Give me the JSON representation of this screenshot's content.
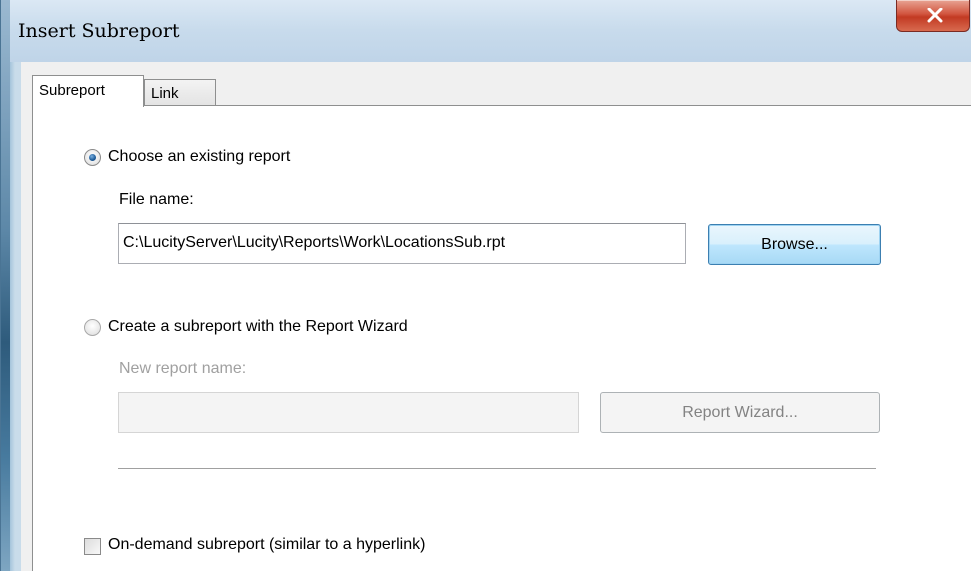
{
  "window": {
    "title": "Insert Subreport",
    "close_glyph": "X"
  },
  "tabs": [
    {
      "label": "Subreport",
      "selected": true
    },
    {
      "label": "Link",
      "selected": false
    }
  ],
  "existing_report": {
    "option_label": "Choose an existing report",
    "selected": true,
    "file_name_label": "File name:",
    "file_name_value": "C:\\LucityServer\\Lucity\\Reports\\Work\\LocationsSub.rpt",
    "browse_label": "Browse..."
  },
  "wizard_report": {
    "option_label": "Create a subreport with the Report Wizard",
    "selected": false,
    "new_name_label": "New report name:",
    "new_name_value": "",
    "wizard_button_label": "Report Wizard..."
  },
  "on_demand": {
    "label": "On-demand subreport (similar to a hyperlink)",
    "checked": false
  },
  "colors": {
    "close_button": "#c23a23",
    "radio_dot": "#1c5a98",
    "focus_border": "#3c7fb1"
  }
}
